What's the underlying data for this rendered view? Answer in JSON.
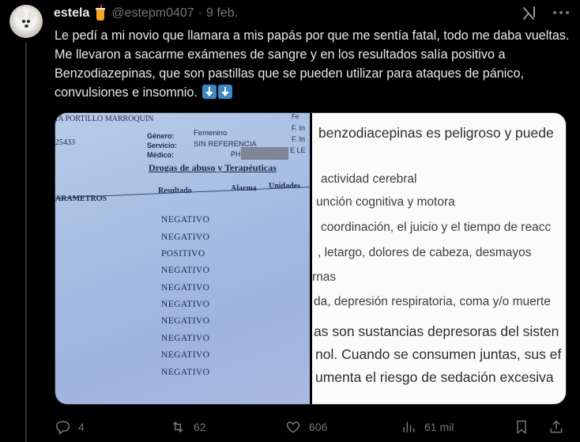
{
  "author": {
    "name": "estela",
    "handle": "@estepm0407",
    "date": "9 feb.",
    "avatar_icon": "dog-avatar"
  },
  "tweet_text": "Le pedí a mi novio que llamara a mis papás por que me sentía fatal, todo me daba vueltas. Me llevaron a sacarme exámenes de sangre y en los resultados salía positivo a Benzodiazepinas, que son pastillas que se pueden utilizar para ataques de pánico, convulsiones e insomnio.",
  "left_image": {
    "name_fragment": "IA PORTILLO MARROQUIN",
    "id_fragment": "25433",
    "field_labels": {
      "genero": "Género:",
      "servicio": "Servicio:",
      "medico": "Médico:"
    },
    "field_values": {
      "genero": "Femenino",
      "servicio": "SIN REFERENCIA",
      "medico_prefix": "PH"
    },
    "right_fragments": [
      "Fe",
      "F. In",
      "F. In",
      "E LE"
    ],
    "section_title": "Drogas de abuso y Terapéuticas",
    "columns": {
      "resultado": "Resultado",
      "alarma": "Alarma",
      "unidades": "Unidades"
    },
    "param_header": "ARAMETROS",
    "results": [
      "NEGATIVO",
      "NEGATIVO",
      "POSITIVO",
      "NEGATIVO",
      "NEGATIVO",
      "NEGATIVO",
      "NEGATIVO",
      "NEGATIVO",
      "NEGATIVO",
      "NEGATIVO"
    ]
  },
  "right_image": {
    "lines": [
      "benzodiacepinas es peligroso y puede",
      "actividad cerebral",
      "unción cognitiva y motora",
      "coordinación, el juicio y el tiempo de reacc",
      ", letargo, dolores de cabeza, desmayos",
      "rnas",
      "da, depresión respiratoria, coma y/o muerte",
      "as son sustancias depresoras del sisten",
      "nol. Cuando se consumen juntas, sus ef",
      "umenta el riesgo de sedación excesiva"
    ]
  },
  "actions": {
    "replies": "4",
    "reposts": "62",
    "likes": "606",
    "views": "61 mil"
  },
  "colors": {
    "background": "#000000",
    "text": "#e7e9ea",
    "muted": "#71767b",
    "border": "#2f3336",
    "emoji_blue": "#3b88c3"
  }
}
